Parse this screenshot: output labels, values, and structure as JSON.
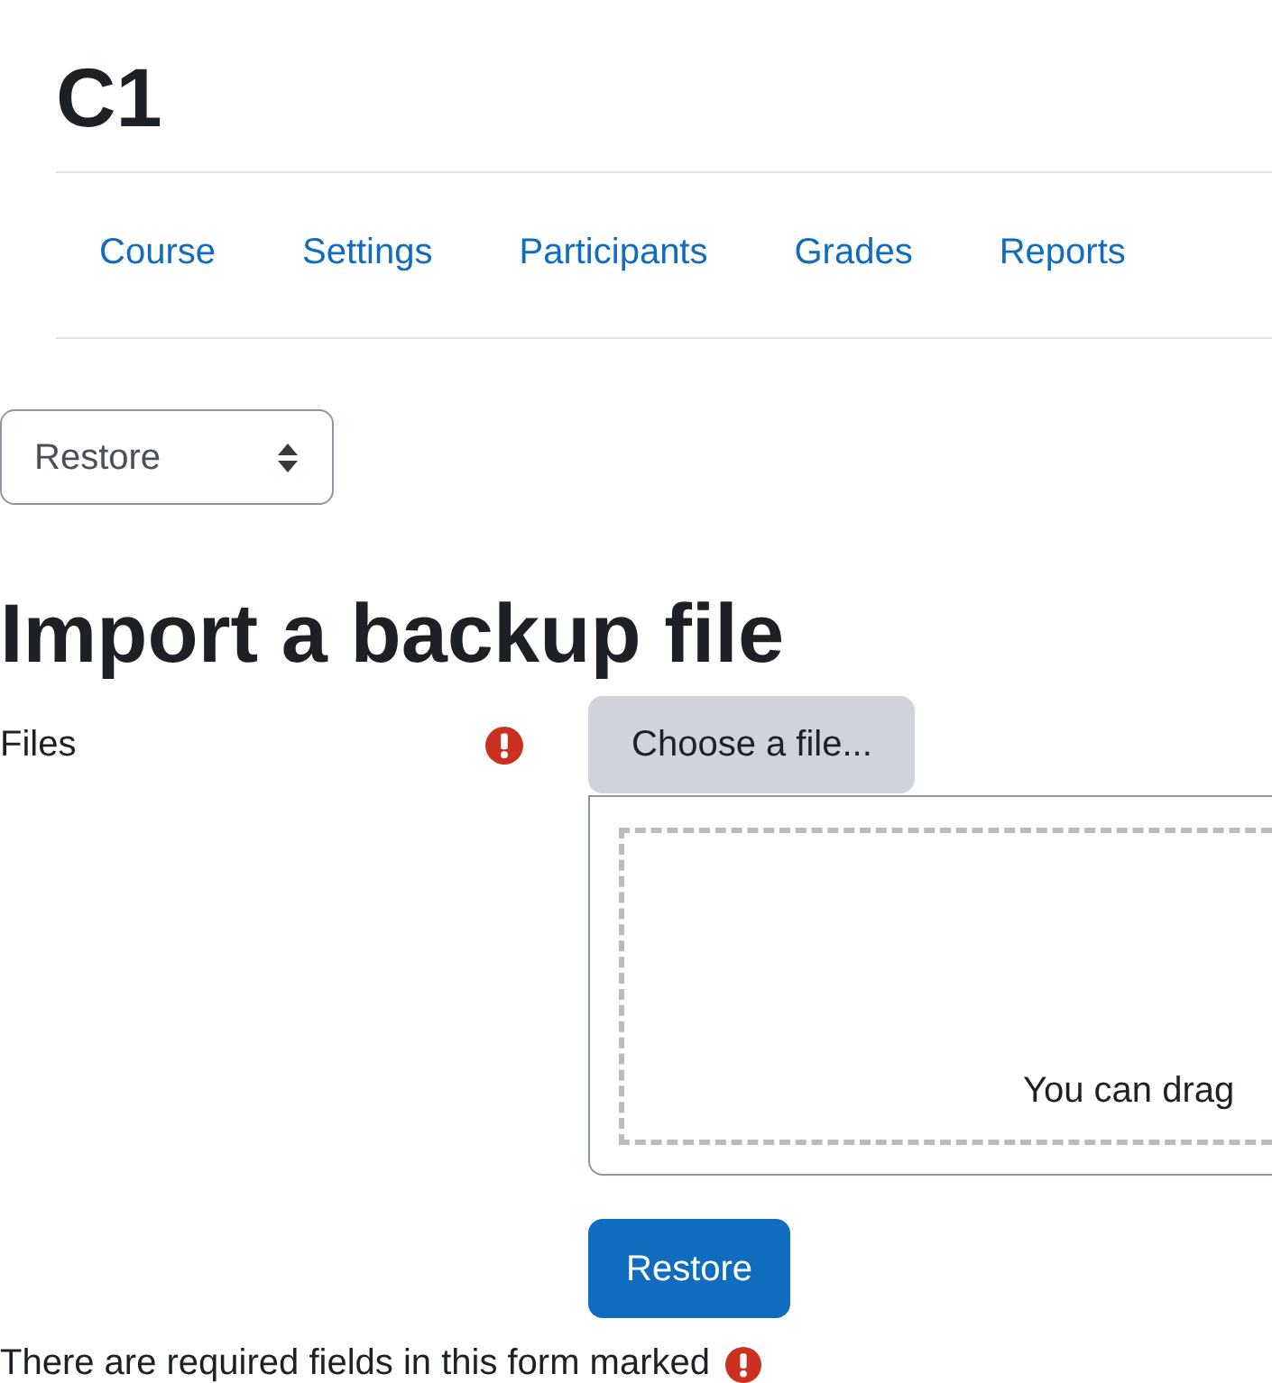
{
  "page_header": {
    "title": "C1"
  },
  "nav_tabs": [
    {
      "label": "Course",
      "selected": false
    },
    {
      "label": "Settings",
      "selected": false
    },
    {
      "label": "Participants",
      "selected": false
    },
    {
      "label": "Grades",
      "selected": false
    },
    {
      "label": "Reports",
      "selected": false
    }
  ],
  "action_menu": {
    "value": "Restore"
  },
  "heading": "Import a backup file",
  "form": {
    "fields": [
      {
        "label": "Files",
        "required": true,
        "choose_button": "Choose a file...",
        "drop_hint": "You can drag"
      }
    ],
    "submit_button": "Restore",
    "required_note": "There are required fields in this form marked"
  }
}
